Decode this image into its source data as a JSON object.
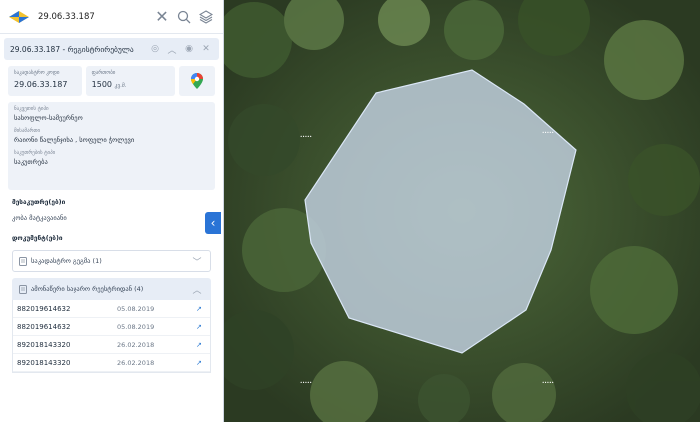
{
  "search": {
    "value": "29.06.33.187"
  },
  "card": {
    "title": "29.06.33.187 - რეგისტრირებულა"
  },
  "fields": {
    "cadastral_label": "საკადასტრო კოდი",
    "cadastral_value": "29.06.33.187",
    "area_label": "ფართობი",
    "area_value": "1500",
    "area_unit": "კვ.მ."
  },
  "details": [
    {
      "label": "ნაკვეთის ტიპი",
      "value": "სასოფლო-სამეურნეო"
    },
    {
      "label": "მისამართი",
      "value": "რაიონი წალენჯიხა , სოფელი ჭოლევი"
    },
    {
      "label": "საკუთრების ტიპი",
      "value": "საკუთრება"
    }
  ],
  "owners": {
    "heading": "მესაკუთრე(ებ)ი",
    "value": "კობა მატკავაიანი"
  },
  "documents": {
    "heading": "დოკუმენტ(ებ)ი"
  },
  "accordions": {
    "cadastral_maps": "საკადასტრო გეგმა (1)",
    "extracts": "ამონაწერი საჯარო რეესტრიდან (4)"
  },
  "extract_rows": [
    {
      "number": "882019614632",
      "date": "05.08.2019"
    },
    {
      "number": "882019614632",
      "date": "05.08.2019"
    },
    {
      "number": "892018143320",
      "date": "26.02.2018"
    },
    {
      "number": "892018143320",
      "date": "26.02.2018"
    }
  ],
  "colors": {
    "accent": "#2a74d6",
    "parcel_fill": "#c9d7ea",
    "parcel_stroke": "#dbe7f7"
  },
  "icons": [
    "logo-icon",
    "clear-icon",
    "search-icon",
    "layers-icon",
    "palette-icon",
    "chevron-up-icon",
    "eye-icon",
    "close-icon",
    "google-maps-icon",
    "document-icon",
    "chevron-down-icon",
    "external-link-icon",
    "chevron-left-icon"
  ]
}
